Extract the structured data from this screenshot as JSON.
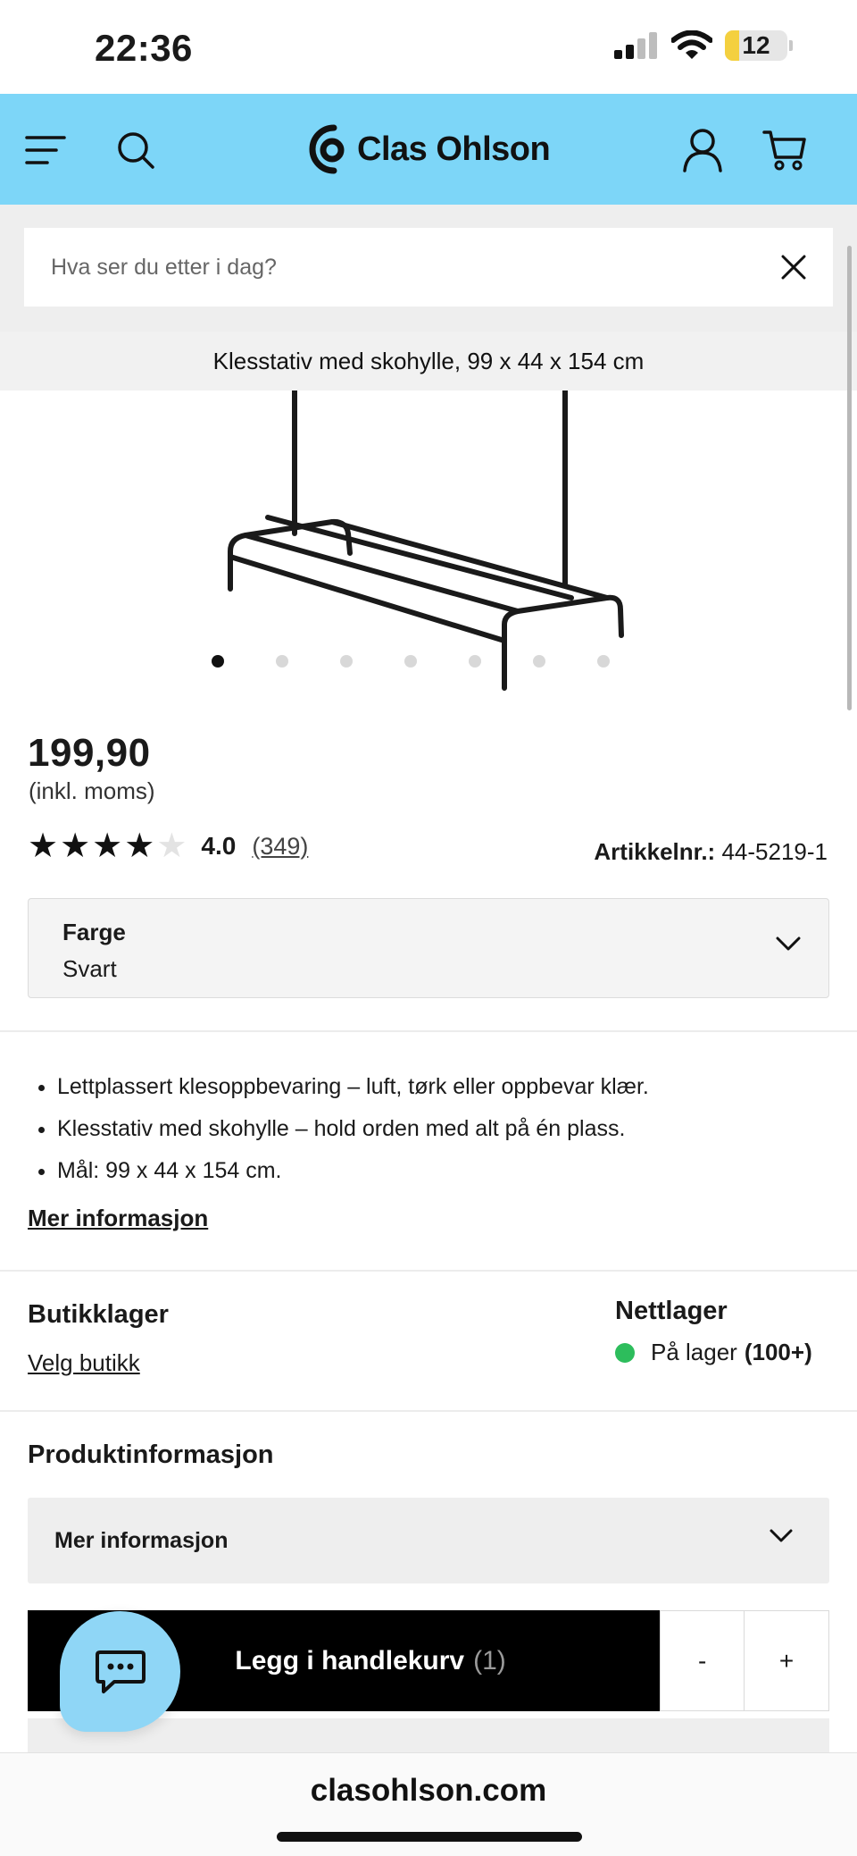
{
  "status_bar": {
    "time": "22:36",
    "battery": "12"
  },
  "nav": {
    "brand": "Clas Ohlson"
  },
  "search": {
    "placeholder": "Hva ser du etter i dag?"
  },
  "product": {
    "title": "Klesstativ med skohylle, 99 x 44 x 154 cm",
    "price": "199,90",
    "price_note": "(inkl. moms)",
    "rating_value": "4.0",
    "rating_stars": 4,
    "rating_count": "(349)",
    "sku_label": "Artikkelnr.:",
    "sku_value": "44-5219-1",
    "gallery_dots": 7,
    "gallery_active": 0
  },
  "color_select": {
    "label": "Farge",
    "value": "Svart"
  },
  "features": [
    "Lettplassert klesoppbevaring – luft, tørk eller oppbevar klær.",
    "Klesstativ med skohylle – hold orden med alt på én plass.",
    "Mål: 99 x 44 x 154 cm."
  ],
  "more_info_link": "Mer informasjon",
  "stock": {
    "store_title": "Butikklager",
    "store_link": "Velg butikk",
    "web_title": "Nettlager",
    "web_status": "På lager",
    "web_count": "(100+)",
    "status_color": "#2dbd5c"
  },
  "product_info": {
    "title": "Produktinformasjon",
    "accordion_label": "Mer informasjon"
  },
  "cart": {
    "button_label": "Legg i handlekurv",
    "count": "(1)",
    "minus": "-",
    "plus": "+"
  },
  "browser": {
    "url": "clasohlson.com"
  },
  "colors": {
    "nav_bg": "#7dd6f8",
    "chat_fab": "#8fd6f6"
  },
  "icons": [
    "menu-icon",
    "search-icon",
    "brand-logo-icon",
    "user-icon",
    "cart-icon",
    "close-icon",
    "chevron-down-icon",
    "chat-icon"
  ]
}
